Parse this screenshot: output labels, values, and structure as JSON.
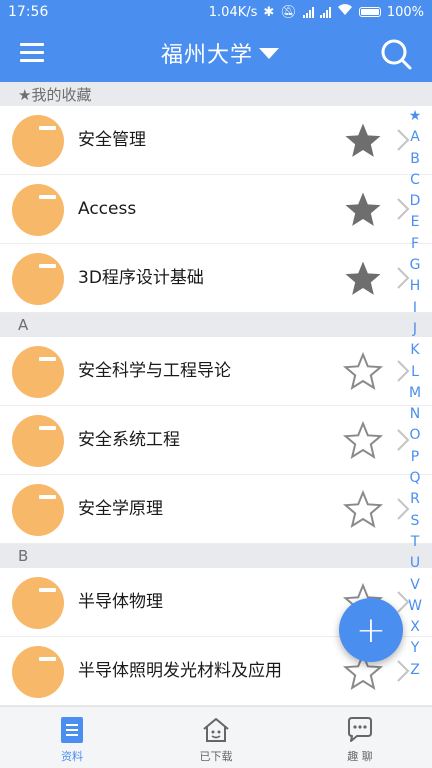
{
  "status_bar": {
    "time": "17:56",
    "network_speed": "1.04K/s",
    "battery": "100%"
  },
  "app_bar": {
    "title": "福州大学",
    "menu_icon": "menu-icon",
    "dropdown_icon": "caret-down-icon",
    "search_icon": "search-icon"
  },
  "sections": [
    {
      "header": "★我的收藏",
      "items": [
        {
          "label": "安全管理",
          "favorited": true
        },
        {
          "label": "Access",
          "favorited": true
        },
        {
          "label": "3D程序设计基础",
          "favorited": true
        }
      ]
    },
    {
      "header": "A",
      "items": [
        {
          "label": "安全科学与工程导论",
          "favorited": false
        },
        {
          "label": "安全系统工程",
          "favorited": false
        },
        {
          "label": "安全学原理",
          "favorited": false
        }
      ]
    },
    {
      "header": "B",
      "items": [
        {
          "label": "半导体物理",
          "favorited": false
        },
        {
          "label": "半导体照明发光材料及应用",
          "favorited": false
        }
      ]
    }
  ],
  "index_letters": [
    "★",
    "A",
    "B",
    "C",
    "D",
    "E",
    "F",
    "G",
    "H",
    "I",
    "J",
    "K",
    "L",
    "M",
    "N",
    "O",
    "P",
    "Q",
    "R",
    "S",
    "T",
    "U",
    "V",
    "W",
    "X",
    "Y",
    "Z"
  ],
  "fab": {
    "label": "+"
  },
  "bottom_tabs": [
    {
      "label": "资料",
      "icon": "document-icon",
      "active": true
    },
    {
      "label": "已下载",
      "icon": "house-icon",
      "active": false
    },
    {
      "label": "趣 聊",
      "icon": "chat-icon",
      "active": false
    }
  ],
  "colors": {
    "primary": "#4a8ff0",
    "avatar": "#f7b86a",
    "star_filled": "#6e6e6e",
    "section_bg": "#e9eaed"
  }
}
